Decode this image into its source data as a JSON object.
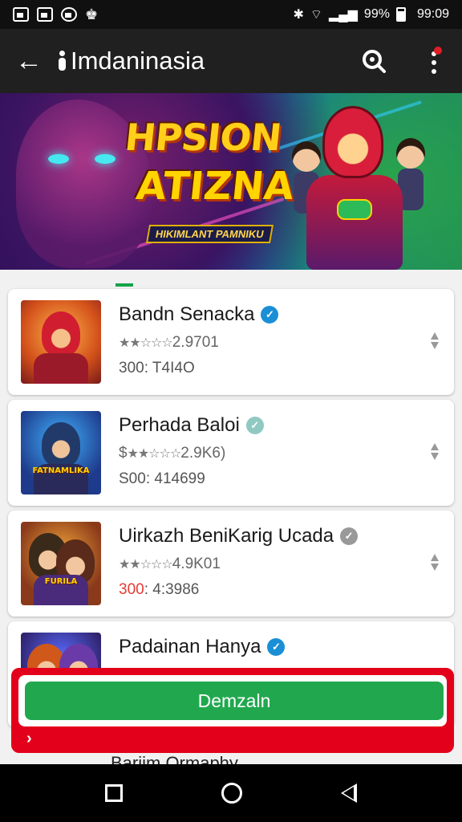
{
  "status_bar": {
    "battery": "99%",
    "time": "99:09",
    "signal_text": "✱ 9"
  },
  "app_bar": {
    "title": "Imdaninasia",
    "back_icon": "arrow-left-icon",
    "search_icon": "search-icon",
    "menu_icon": "more-vertical-icon",
    "menu_badge_color": "#e01e26"
  },
  "banner": {
    "title_line1": "HPSION",
    "title_line2": "ATIZNA",
    "tagline": "HIKIMLANT PAMNIKU"
  },
  "apps": [
    {
      "name": "Bandn Senacka",
      "rating": "2.9701",
      "stars": "★★☆☆☆",
      "rating_prefix": "",
      "price": "300",
      "downloads": "T4I4O",
      "verified_color": "#1a8fd6",
      "verified_glyph": "✓"
    },
    {
      "name": "Perhada Baloi",
      "rating": "2.9K6)",
      "stars": "★★☆☆☆",
      "rating_prefix": "$",
      "price": "S00",
      "downloads": "414699",
      "verified_color": "#8fc9c2",
      "verified_glyph": "✓"
    },
    {
      "name": "Uirkazh BeniKarig Ucada",
      "rating": "4.9K01",
      "stars": "★★☆☆☆",
      "rating_prefix": "",
      "price": "300",
      "downloads": "4:3986",
      "verified_color": "#999999",
      "verified_glyph": "✓"
    },
    {
      "name": "Padainan Hanya",
      "rating": "",
      "stars": "",
      "rating_prefix": "",
      "price": "",
      "downloads": "",
      "verified_color": "#1a8fd6",
      "verified_glyph": "✓"
    }
  ],
  "thumb_labels": [
    "",
    "FATNAMLIKA",
    "FURILA"
  ],
  "cta": {
    "label": "Demzaln",
    "arrow": "›"
  },
  "peek_text": "Bariim Ormaphy",
  "nav": {
    "back_icon": "triangle-back-icon",
    "home_icon": "circle-home-icon",
    "recent_icon": "square-recents-icon"
  }
}
